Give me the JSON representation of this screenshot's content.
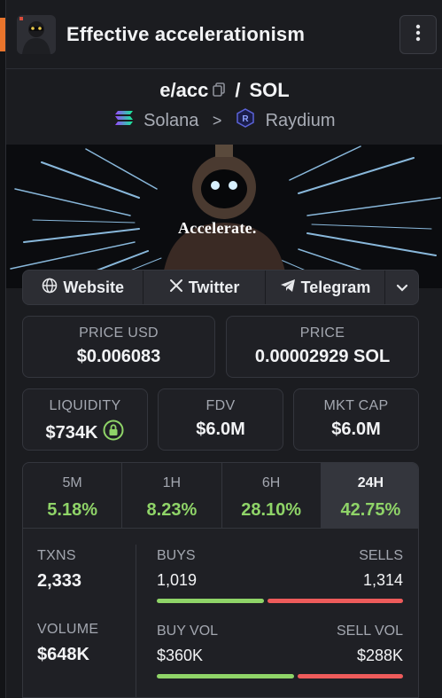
{
  "header": {
    "title": "Effective accelerationism"
  },
  "pair": {
    "base": "e/acc",
    "separator": "/",
    "quote": "SOL",
    "chain": "Solana",
    "chevron": ">",
    "dex": "Raydium"
  },
  "banner": {
    "text": "Accelerate."
  },
  "links": {
    "website": "Website",
    "twitter": "Twitter",
    "telegram": "Telegram"
  },
  "price_usd": {
    "label": "PRICE USD",
    "value": "$0.006083"
  },
  "price_native": {
    "label": "PRICE",
    "value": "0.00002929 SOL"
  },
  "liquidity": {
    "label": "LIQUIDITY",
    "value": "$734K"
  },
  "fdv": {
    "label": "FDV",
    "value": "$6.0M"
  },
  "mkt_cap": {
    "label": "MKT CAP",
    "value": "$6.0M"
  },
  "timeframes": [
    {
      "label": "5M",
      "value": "5.18%"
    },
    {
      "label": "1H",
      "value": "8.23%"
    },
    {
      "label": "6H",
      "value": "28.10%"
    },
    {
      "label": "24H",
      "value": "42.75%"
    }
  ],
  "active_timeframe": "24H",
  "txns": {
    "label": "TXNS",
    "value": "2,333"
  },
  "volume": {
    "label": "VOLUME",
    "value": "$648K"
  },
  "buys": {
    "label": "BUYS",
    "value": "1,019"
  },
  "sells": {
    "label": "SELLS",
    "value": "1,314"
  },
  "buy_vol": {
    "label": "BUY VOL",
    "value": "$360K"
  },
  "sell_vol": {
    "label": "SELL VOL",
    "value": "$288K"
  },
  "ratios": {
    "buys_fraction": 0.437,
    "buy_vol_fraction": 0.556
  },
  "colors": {
    "positive": "#8fd468",
    "negative": "#ee5b5b",
    "accent": "#e8742c"
  },
  "icons": {
    "menu": "vertical-dots-icon",
    "copy": "copy-icon",
    "chain": "solana-icon",
    "dex": "raydium-icon",
    "website": "globe-icon",
    "twitter": "x-icon",
    "telegram": "telegram-icon",
    "expand": "chevron-down-icon",
    "lock": "lock-icon"
  }
}
